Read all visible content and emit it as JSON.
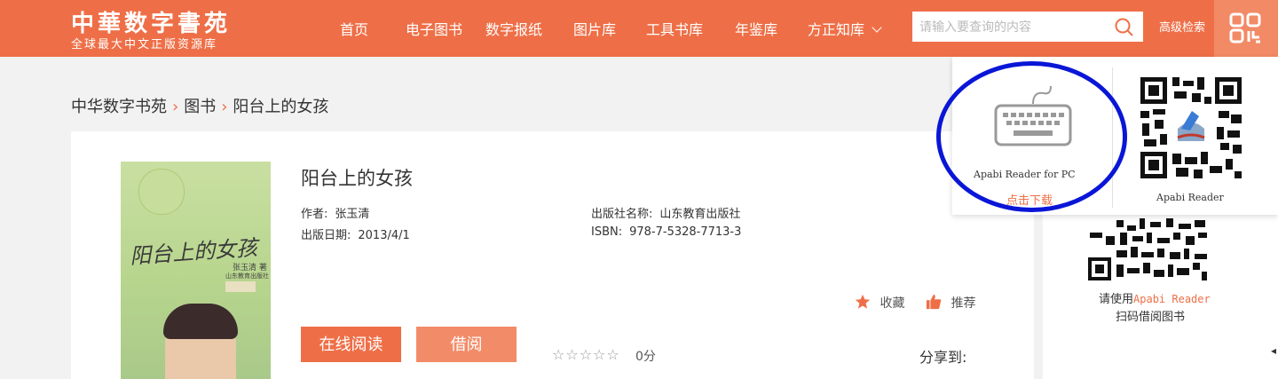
{
  "header": {
    "logo_title": "中華数字書苑",
    "logo_subtitle": "全球最大中文正版资源库",
    "nav": [
      "首页",
      "电子图书",
      "数字报纸",
      "图片库",
      "工具书库",
      "年鉴库",
      "方正知库"
    ],
    "search_placeholder": "请输入要查询的内容",
    "advanced_search": "高级检索"
  },
  "breadcrumb": [
    "中华数字书苑",
    "图书",
    "阳台上的女孩"
  ],
  "book": {
    "title": "阳台上的女孩",
    "author_label": "作者:",
    "author": "张玉清",
    "publisher_label": "出版社名称:",
    "publisher": "山东教育出版社",
    "date_label": "出版日期:",
    "date": "2013/4/1",
    "isbn_label": "ISBN:",
    "isbn": "978-7-5328-7713-3",
    "cover": {
      "title": "阳台上的女孩",
      "author": "张玉清 著",
      "publisher": "山东教育出版社"
    }
  },
  "actions": {
    "favorite": "收藏",
    "recommend": "推荐",
    "read_online": "在线阅读",
    "borrow": "借阅",
    "stars": "☆☆☆☆☆",
    "rating": "0分",
    "share": "分享到:"
  },
  "popup": {
    "pc_label": "Apabi Reader for PC",
    "download": "点击下载",
    "mobile_label": "Apabi Reader"
  },
  "sidebar": {
    "tip_prefix": "请使用",
    "tip_app": "Apabi Reader",
    "tip_suffix": "扫码借阅图书"
  },
  "colors": {
    "brand": "#ee6f47",
    "brand_light": "#f28c68",
    "annotation_circle": "#0a16d6"
  }
}
